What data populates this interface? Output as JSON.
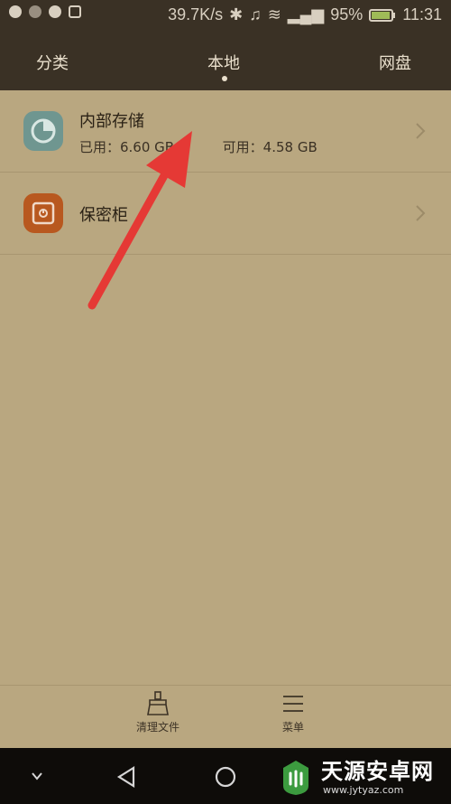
{
  "statusbar": {
    "speed": "39.7K/s",
    "battery": "95%",
    "time": "11:31"
  },
  "tabs": [
    {
      "label": "分类"
    },
    {
      "label": "本地"
    },
    {
      "label": "网盘"
    }
  ],
  "list": [
    {
      "title": "内部存储",
      "used": "已用：6.60 GB",
      "available": "可用：4.58 GB",
      "icon": "pie-chart-icon"
    },
    {
      "title": "保密柜",
      "icon": "safe-icon"
    }
  ],
  "bottom": {
    "clean_label": "清理文件",
    "menu_label": "菜单"
  },
  "watermark": {
    "title": "天源安卓网",
    "url": "www.jytyaz.com"
  },
  "colors": {
    "background": "#b9a780",
    "header": "#3a3125",
    "arrow": "#e53935"
  }
}
